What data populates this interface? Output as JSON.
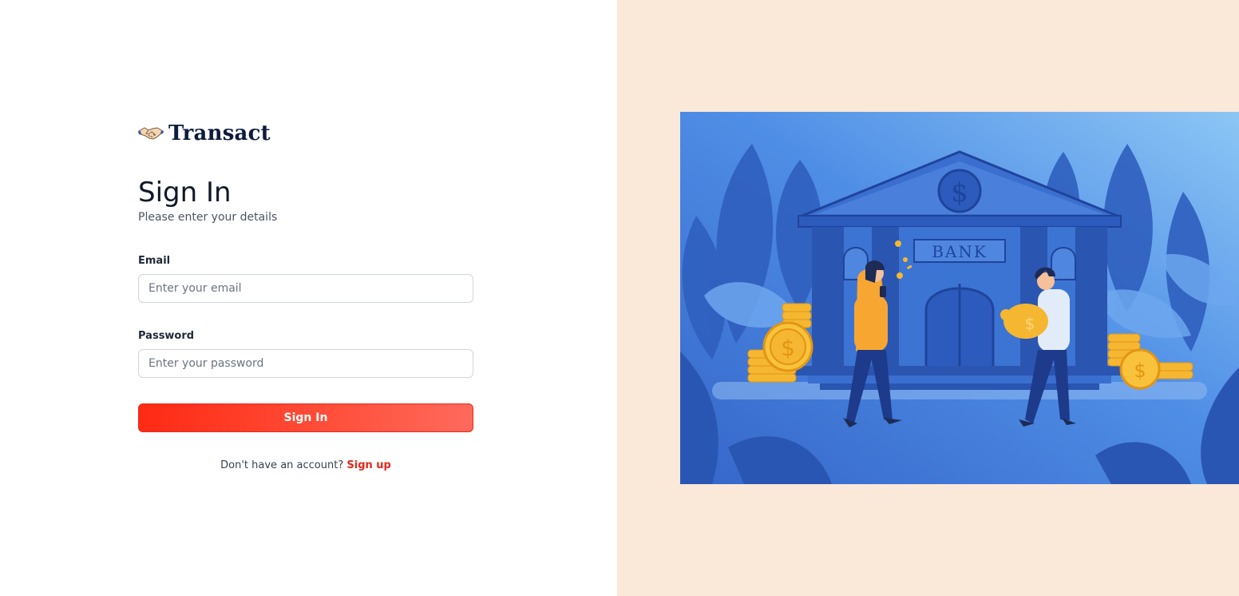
{
  "brand": {
    "name": "Transact",
    "logo_icon": "handshake-icon"
  },
  "form": {
    "title": "Sign In",
    "subtitle": "Please enter your details",
    "email_label": "Email",
    "email_placeholder": "Enter your email",
    "email_value": "",
    "password_label": "Password",
    "password_placeholder": "Enter your password",
    "password_value": "",
    "submit_label": "Sign In",
    "signup_prompt": "Don't have an account?",
    "signup_link": "Sign up"
  },
  "illustration": {
    "bank_sign": "BANK",
    "seal_symbol": "$"
  },
  "colors": {
    "accent": "#ff2a14",
    "right_panel_bg": "#fae8d9",
    "brand_text": "#0d1b3e",
    "illustration_bg": "#4a86e0"
  }
}
